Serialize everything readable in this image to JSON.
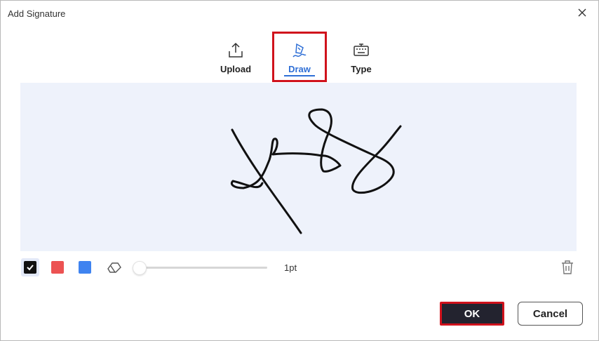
{
  "dialog": {
    "title": "Add Signature"
  },
  "tabs": [
    {
      "label": "Upload",
      "icon": "upload-icon"
    },
    {
      "label": "Draw",
      "icon": "pen-icon",
      "active": true
    },
    {
      "label": "Type",
      "icon": "keyboard-icon"
    }
  ],
  "toolbar": {
    "colors": [
      "#111111",
      "#ec5252",
      "#3f83f0"
    ],
    "selected_color": "#111111",
    "size_label": "1pt",
    "size_fraction": 0.0
  },
  "footer": {
    "ok_label": "OK",
    "cancel_label": "Cancel"
  },
  "theme": {
    "accent": "#2f6fd6",
    "highlight": "#d0121c",
    "canvas_bg": "#eef2fb"
  }
}
